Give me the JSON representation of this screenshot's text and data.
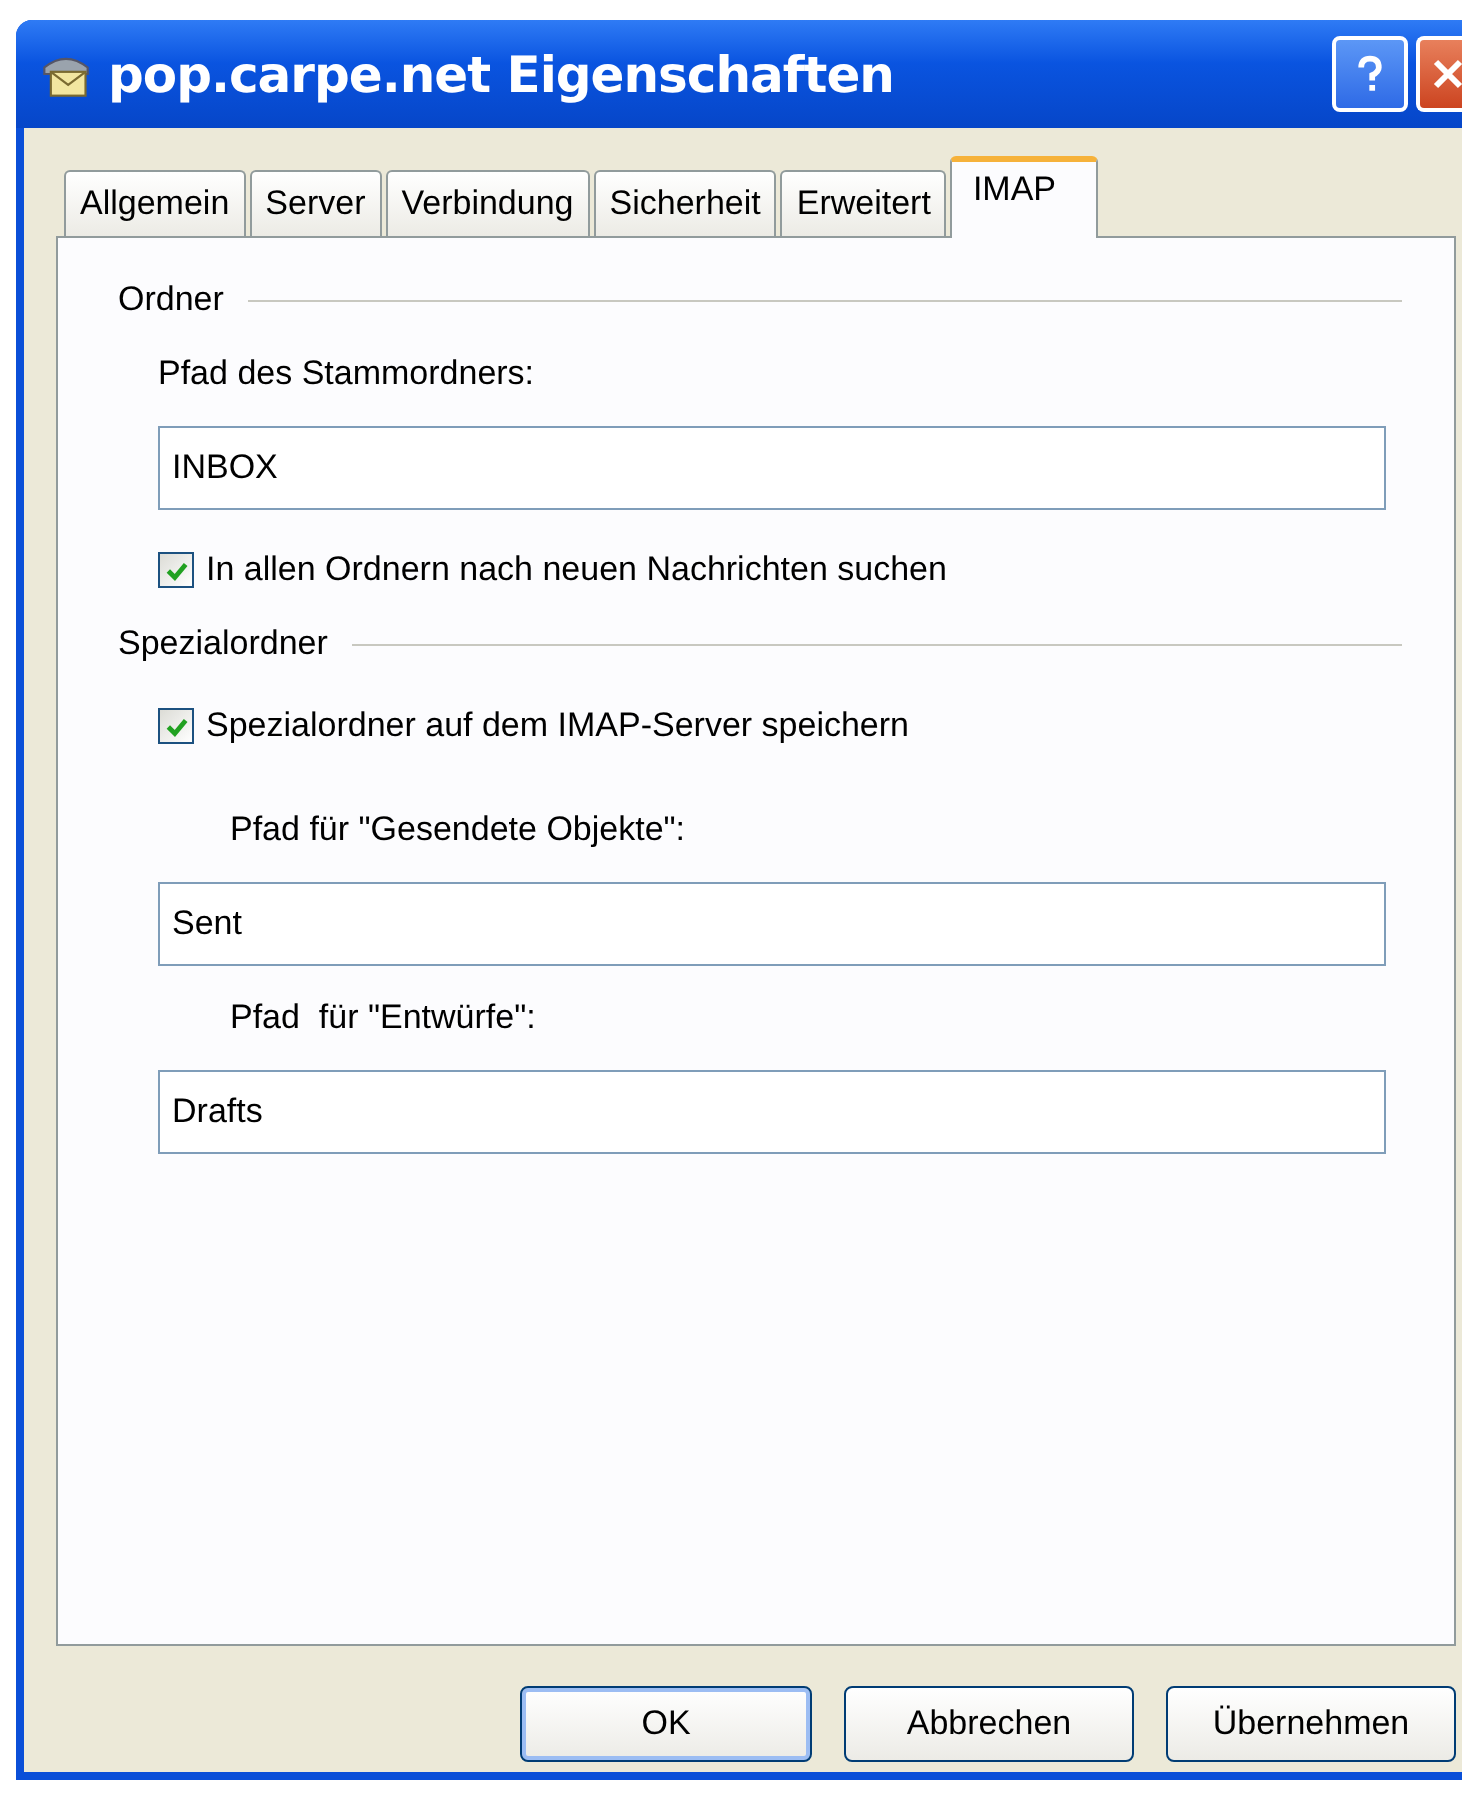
{
  "window": {
    "title": "pop.carpe.net Eigenschaften"
  },
  "tabs": [
    {
      "label": "Allgemein",
      "selected": false
    },
    {
      "label": "Server",
      "selected": false
    },
    {
      "label": "Verbindung",
      "selected": false
    },
    {
      "label": "Sicherheit",
      "selected": false
    },
    {
      "label": "Erweitert",
      "selected": false
    },
    {
      "label": "IMAP",
      "selected": true
    }
  ],
  "groups": [
    {
      "title": "Ordner",
      "items": [
        {
          "kind": "label",
          "text": "Pfad des Stammordners:"
        },
        {
          "kind": "field",
          "value": "INBOX"
        },
        {
          "kind": "checkbox",
          "label": "In allen Ordnern nach neuen Nachrichten suchen",
          "checked": true
        }
      ]
    },
    {
      "title": "Spezialordner",
      "items": [
        {
          "kind": "checkbox",
          "label": "Spezialordner auf dem IMAP-Server speichern",
          "checked": true
        },
        {
          "kind": "label",
          "text": "Pfad für \"Gesendete Objekte\":"
        },
        {
          "kind": "field",
          "value": "Sent"
        },
        {
          "kind": "label",
          "text": "Pfad  für \"Entwürfe\":"
        },
        {
          "kind": "field",
          "value": "Drafts"
        }
      ]
    }
  ],
  "buttons": [
    {
      "label": "OK",
      "default": true
    },
    {
      "label": "Abbrechen",
      "default": false
    },
    {
      "label": "Übernehmen",
      "default": false
    }
  ]
}
